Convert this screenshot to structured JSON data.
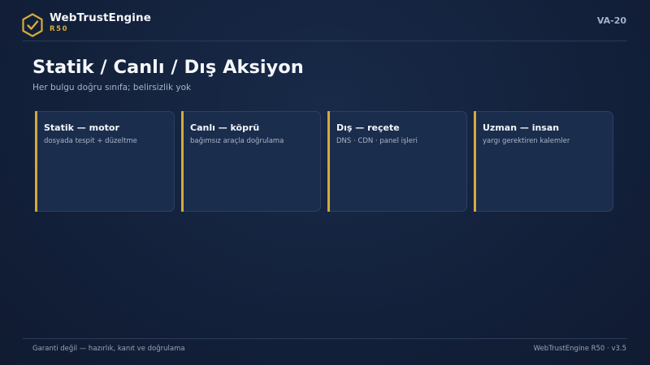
{
  "header": {
    "logo_icon": "shield-check-icon",
    "brand_name": "WebTrustEngine",
    "brand_sub": "R50",
    "code": "VA-20"
  },
  "main": {
    "title": "Statik / Canlı / Dış Aksiyon",
    "subtitle": "Her bulgu doğru sınıfa; belirsizlik yok"
  },
  "cards": [
    {
      "title": "Statik — motor",
      "desc": "dosyada tespit + düzeltme"
    },
    {
      "title": "Canlı — köprü",
      "desc": "bağımsız araçla doğrulama"
    },
    {
      "title": "Dış — reçete",
      "desc": "DNS · CDN · panel işleri"
    },
    {
      "title": "Uzman — insan",
      "desc": "yargı gerektiren kalemler"
    }
  ],
  "footer": {
    "left": "Garanti değil — hazırlık, kanıt ve doğrulama",
    "right": "WebTrustEngine R50 · v3.5"
  },
  "colors": {
    "background": "#14203a",
    "accent": "#d6a93b",
    "card": "#1b2d4c"
  }
}
